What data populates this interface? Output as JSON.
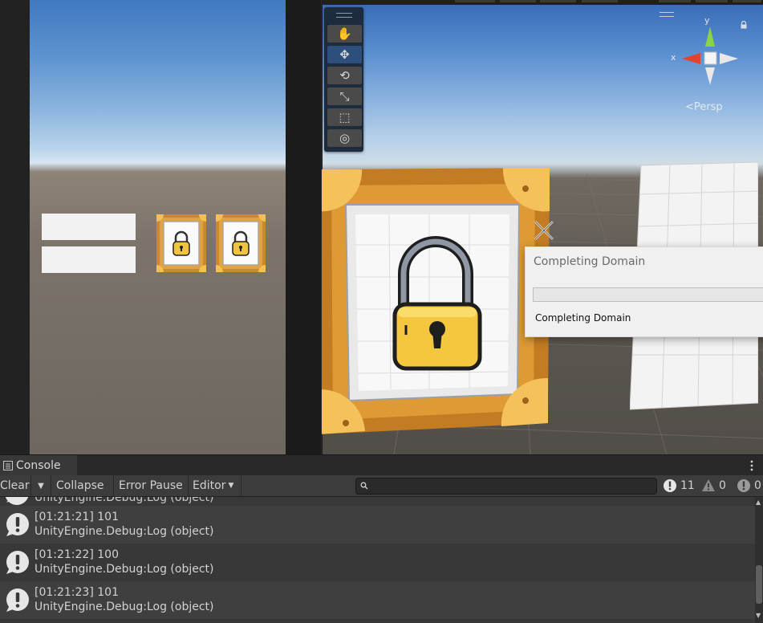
{
  "game": {},
  "scene": {
    "gizmo_y": "y",
    "gizmo_x": "x",
    "persp": "Persp"
  },
  "dialog": {
    "title": "Completing Domain",
    "message": "Completing Domain",
    "progress": 0
  },
  "console": {
    "tab_label": "Console",
    "toolbar": {
      "clear": "Clear",
      "collapse": "Collapse",
      "error_pause": "Error Pause",
      "editor": "Editor"
    },
    "search_value": "",
    "counts": {
      "logs": "11",
      "warnings": "0",
      "errors": "0"
    },
    "partial_row": "UnityEngine.Debug:Log (object)",
    "entries": [
      {
        "time_value": "[01:21:21] 101",
        "source": "UnityEngine.Debug:Log (object)"
      },
      {
        "time_value": "[01:21:22] 100",
        "source": "UnityEngine.Debug:Log (object)"
      },
      {
        "time_value": "[01:21:23] 101",
        "source": "UnityEngine.Debug:Log (object)"
      }
    ]
  }
}
